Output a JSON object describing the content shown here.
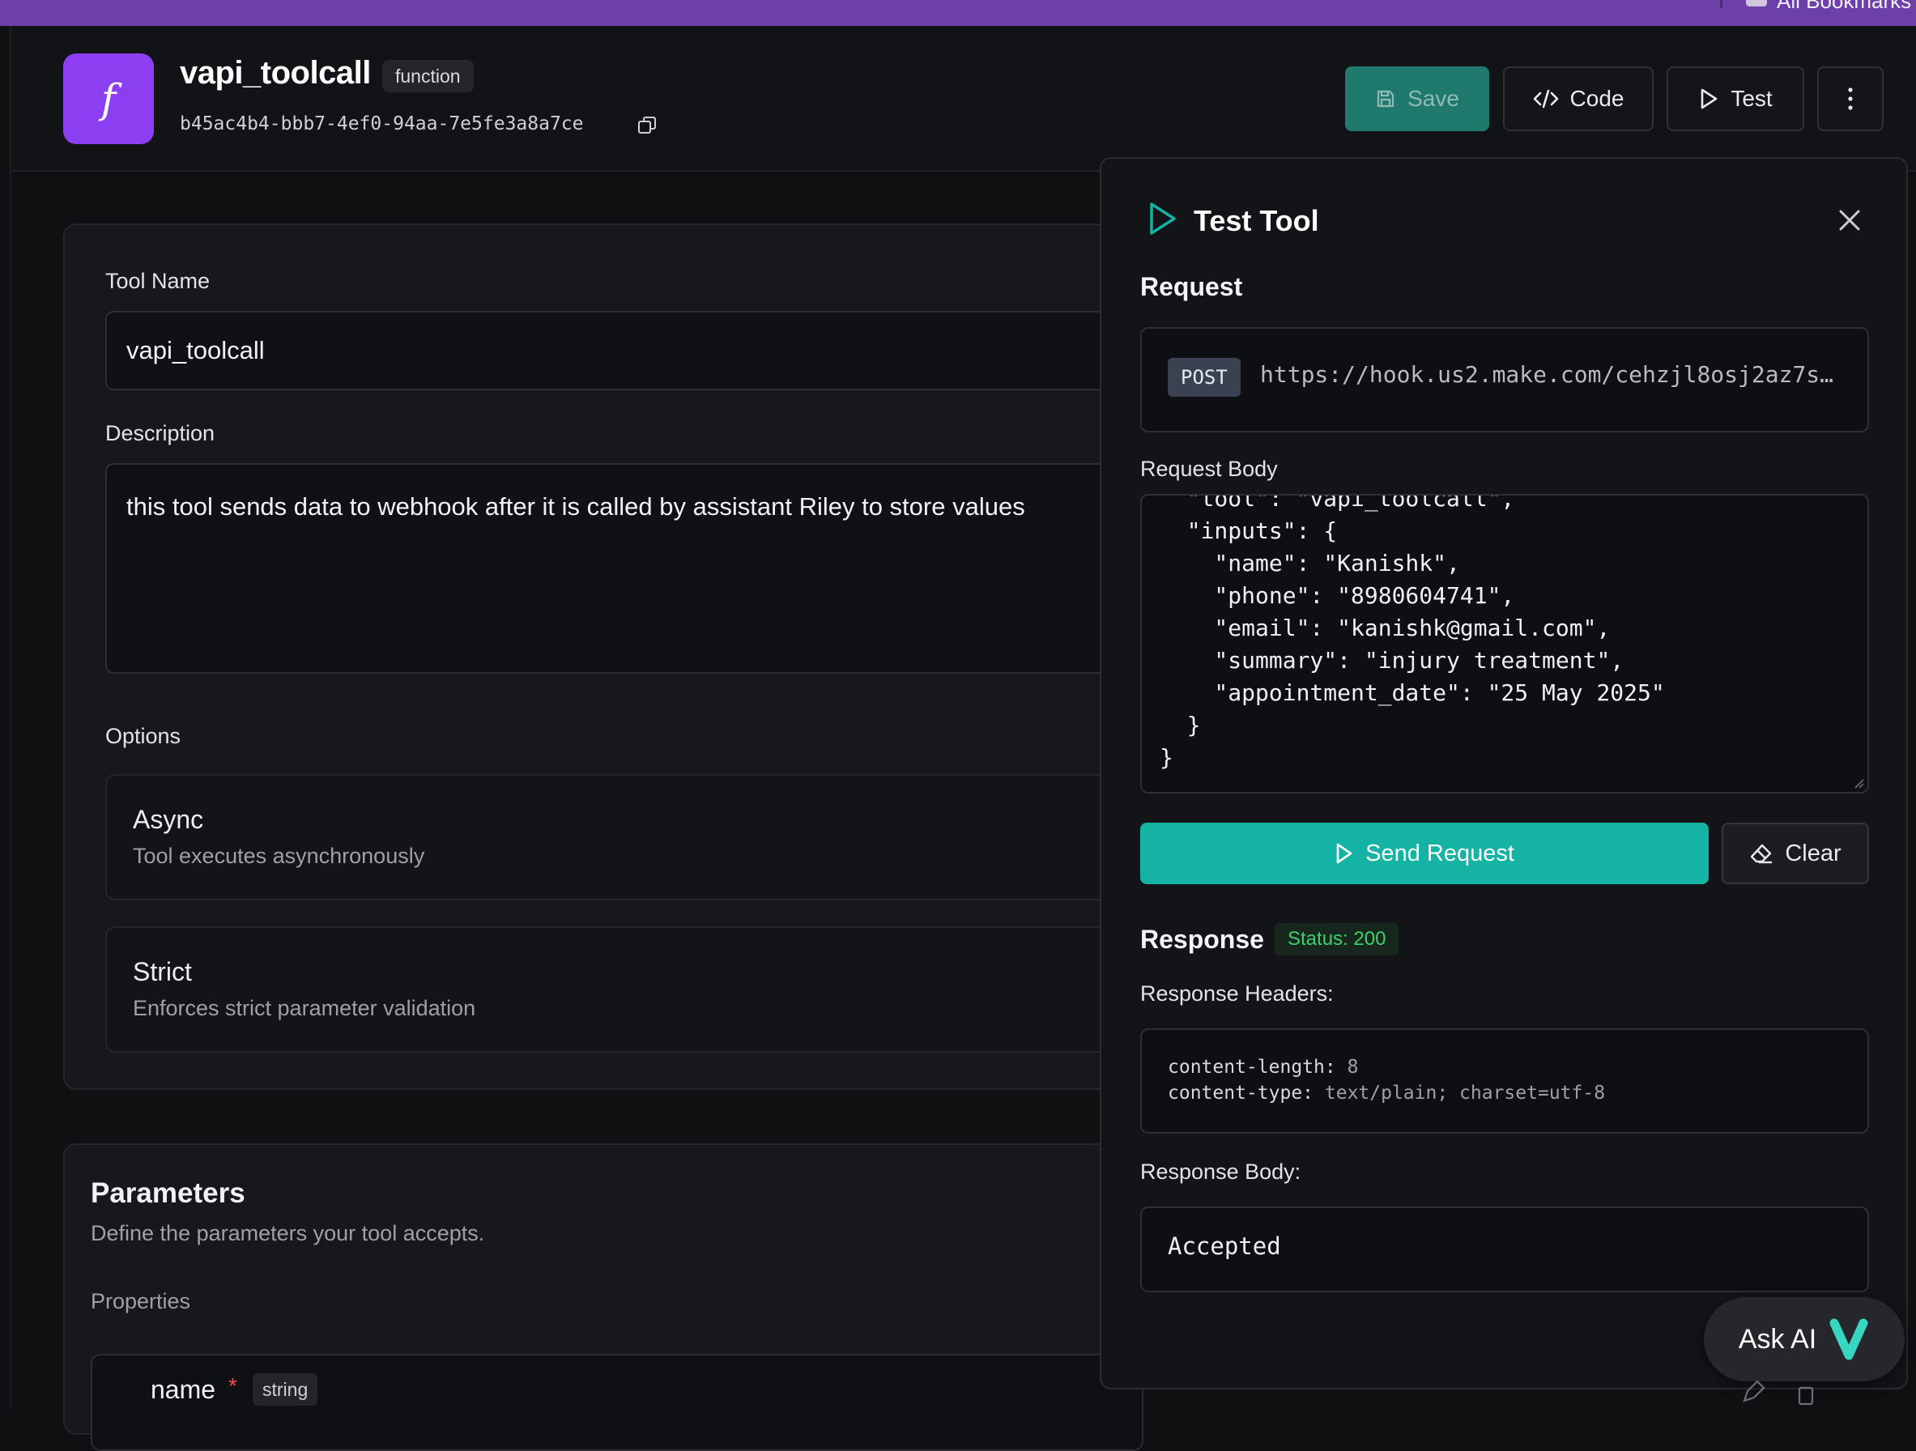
{
  "browser": {
    "bookmarks_label": "All Bookmarks"
  },
  "header": {
    "logo_glyph": "f",
    "title": "vapi_toolcall",
    "type_badge": "function",
    "id": "b45ac4b4-bbb7-4ef0-94aa-7e5fe3a8a7ce",
    "buttons": {
      "save": "Save",
      "code": "Code",
      "test": "Test"
    }
  },
  "form": {
    "tool_name_label": "Tool Name",
    "tool_name_value": "vapi_toolcall",
    "description_label": "Description",
    "description_value": "this tool sends data to webhook after it is called by assistant Riley to store values",
    "options_label": "Options",
    "options": [
      {
        "title": "Async",
        "subtitle": "Tool executes asynchronously"
      },
      {
        "title": "Strict",
        "subtitle": "Enforces strict parameter validation"
      }
    ]
  },
  "parameters": {
    "title": "Parameters",
    "subtitle": "Define the parameters your tool accepts.",
    "properties_label": "Properties",
    "rows": [
      {
        "name": "name",
        "required_mark": "*",
        "type": "string"
      }
    ]
  },
  "test_panel": {
    "title": "Test Tool",
    "request_label": "Request",
    "method": "POST",
    "url": "https://hook.us2.make.com/cehzjl8osj2az7s…",
    "request_body_label": "Request Body",
    "request_body": "  \"tool\": \"vapi_toolcall\",\n  \"inputs\": {\n    \"name\": \"Kanishk\",\n    \"phone\": \"8980604741\",\n    \"email\": \"kanishk@gmail.com\",\n    \"summary\": \"injury treatment\",\n    \"appointment_date\": \"25 May 2025\"\n  }\n}",
    "send_label": "Send Request",
    "clear_label": "Clear",
    "response_label": "Response",
    "status": "Status: 200",
    "response_headers_label": "Response Headers:",
    "response_headers": [
      {
        "key": "content-length:",
        "value": "8"
      },
      {
        "key": "content-type:",
        "value": "text/plain; charset=utf-8"
      }
    ],
    "response_body_label": "Response Body:",
    "response_body": "Accepted"
  },
  "assistant": {
    "label": "Ask AI"
  },
  "colors": {
    "accent_teal": "#14b3a3",
    "brand_purple": "#8b3ff0",
    "status_green": "#3bd16f"
  }
}
